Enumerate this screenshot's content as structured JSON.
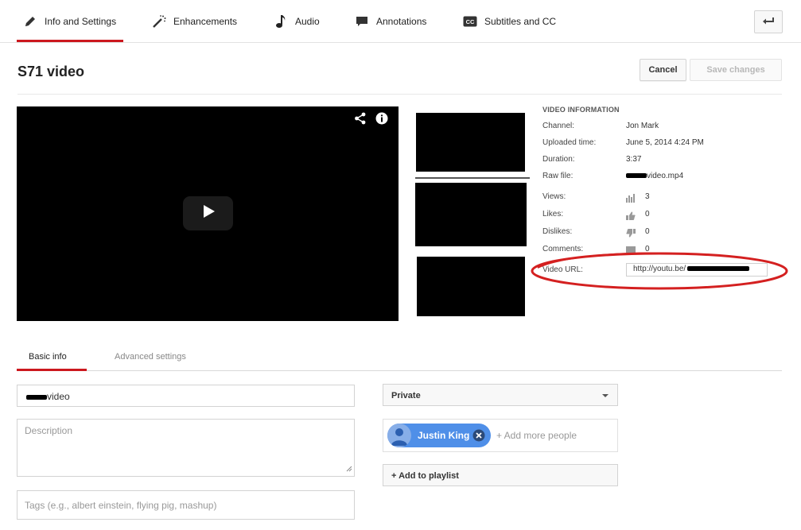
{
  "tabs": [
    {
      "label": "Info and Settings",
      "icon": "pencil-icon",
      "active": true
    },
    {
      "label": "Enhancements",
      "icon": "magic-wand-icon",
      "active": false
    },
    {
      "label": "Audio",
      "icon": "music-note-icon",
      "active": false
    },
    {
      "label": "Annotations",
      "icon": "speech-bubble-icon",
      "active": false
    },
    {
      "label": "Subtitles and CC",
      "icon": "cc-icon",
      "active": false
    }
  ],
  "page": {
    "title": "S71 video",
    "cancel_label": "Cancel",
    "save_label": "Save changes"
  },
  "video_info": {
    "heading": "VIDEO INFORMATION",
    "channel_label": "Channel:",
    "channel_value": "Jon Mark",
    "uploaded_label": "Uploaded time:",
    "uploaded_value": "June 5, 2014 4:24 PM",
    "duration_label": "Duration:",
    "duration_value": "3:37",
    "raw_label": "Raw file:",
    "raw_value": "video.mp4",
    "views_label": "Views:",
    "views_value": "3",
    "likes_label": "Likes:",
    "likes_value": "0",
    "dislikes_label": "Dislikes:",
    "dislikes_value": "0",
    "comments_label": "Comments:",
    "comments_value": "0",
    "url_label": "Video URL:",
    "url_value": "http://youtu.be/"
  },
  "subtabs": {
    "basic": "Basic info",
    "advanced": "Advanced settings"
  },
  "form": {
    "title_value": "video",
    "description_placeholder": "Description",
    "tags_placeholder": "Tags (e.g., albert einstein, flying pig, mashup)",
    "privacy_value": "Private",
    "person_name": "Justin King",
    "add_people_placeholder": "+ Add more people",
    "add_playlist_label": "+ Add to playlist"
  },
  "colors": {
    "accent_red": "#cc181e",
    "chip_blue": "#4f8fe8",
    "annotation_ellipse": "#d42020"
  }
}
